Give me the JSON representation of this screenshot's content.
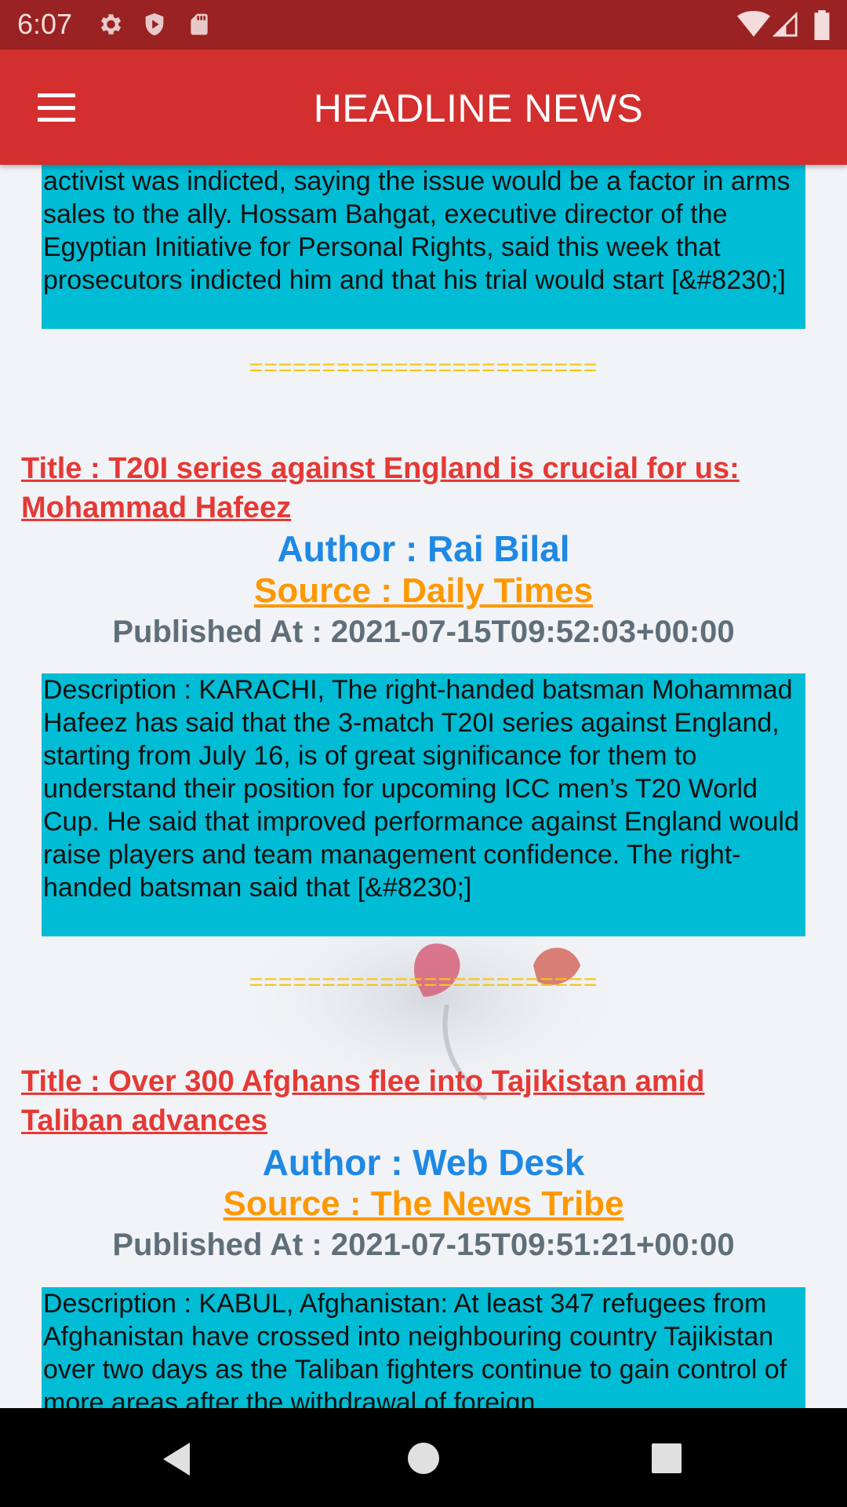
{
  "status_bar": {
    "time": "6:07",
    "icons": [
      "gear-icon",
      "shield-icon",
      "sd-card-icon",
      "wifi-icon",
      "signal-icon",
      "battery-icon"
    ]
  },
  "app_bar": {
    "title": "HEADLINE NEWS",
    "menu_icon": "hamburger-menu-icon",
    "color": "#d32f2f"
  },
  "articles": [
    {
      "description": "activist was indicted, saying the issue would be a factor in arms sales to the ally. Hossam Bahgat, executive director of the Egyptian Initiative for Personal Rights, said this week that prosecutors indicted him and that his trial would start [&#8230;]",
      "separator": "========================"
    },
    {
      "title": "Title : T20I series against England is crucial for us: Mohammad Hafeez",
      "author": "Author : Rai Bilal",
      "source": "Source : Daily Times",
      "published": "Published At : 2021-07-15T09:52:03+00:00",
      "description": "Description : KARACHI, The right-handed batsman Mohammad Hafeez has said that the 3-match T20I series against England, starting from July 16, is of great significance for them to understand their position for upcoming ICC men’s T20 World Cup. He said that improved performance against England would raise players and team management confidence. The right-handed batsman said that [&#8230;]",
      "separator": "========================"
    },
    {
      "title": "Title : Over 300 Afghans flee into Tajikistan amid Taliban advances",
      "author": "Author : Web Desk",
      "source": "Source : The News Tribe",
      "published": "Published At : 2021-07-15T09:51:21+00:00",
      "description": "Description : KABUL, Afghanistan: At least 347 refugees from Afghanistan have crossed into neighbouring country Tajikistan over two days as the Taliban fighters continue to gain control of more areas after the withdrawal of foreign"
    }
  ],
  "nav_bar": {
    "back": "back-triangle-icon",
    "home": "home-circle-icon",
    "recents": "recents-square-icon"
  },
  "colors": {
    "status_bar": "#9a2222",
    "description_bg": "#00bcd4",
    "title": "#e53935",
    "author": "#1e88e5",
    "source": "#ff9800",
    "published": "#5f6f7a",
    "separator": "#f5c518"
  }
}
